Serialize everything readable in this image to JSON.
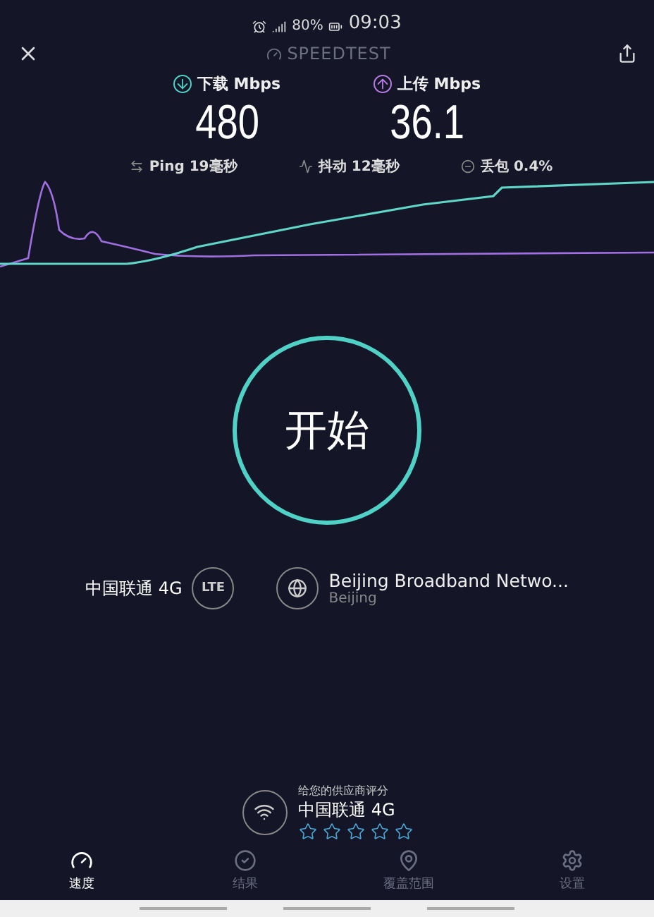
{
  "status_bar": {
    "battery": "80%",
    "time": "09:03"
  },
  "header": {
    "title": "SPEEDTEST"
  },
  "results": [
    {
      "kind": "download",
      "label": "下载",
      "unit": "Mbps",
      "value": "480"
    },
    {
      "kind": "upload",
      "label": "上传",
      "unit": "Mbps",
      "value": "36.1"
    }
  ],
  "metrics": [
    {
      "kind": "ping",
      "label": "Ping",
      "value": "19毫秒"
    },
    {
      "kind": "jitter",
      "label": "抖动",
      "value": "12毫秒"
    },
    {
      "kind": "loss",
      "label": "丢包",
      "value": "0.4%"
    }
  ],
  "start_button": {
    "label": "开始"
  },
  "connection": {
    "carrier": "中国联通 4G",
    "network_badge": "LTE",
    "server": "Beijing Broadband Netwo...",
    "server_location": "Beijing"
  },
  "rating": {
    "prompt": "给您的供应商评分",
    "carrier": "中国联通 4G",
    "stars": 0
  },
  "tabs": [
    {
      "label": "速度",
      "selected": true
    },
    {
      "label": "结果",
      "selected": false
    },
    {
      "label": "覆盖范围",
      "selected": false
    },
    {
      "label": "设置",
      "selected": false
    }
  ]
}
